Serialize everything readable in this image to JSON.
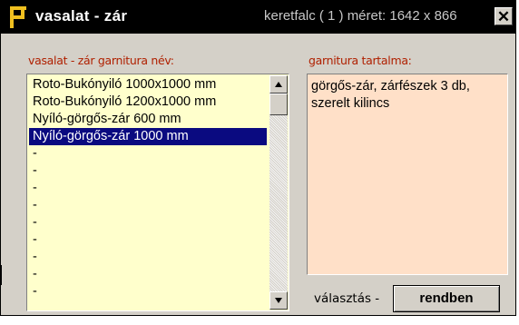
{
  "window": {
    "title": "vasalat - zár",
    "info": "keretfalc ( 1 ) méret: 1642 x 866",
    "close_glyph": "✕"
  },
  "list": {
    "label": "vasalat - zár garnitura név:",
    "items": [
      "Roto-Bukónyiló 1000x1000 mm",
      "Roto-Bukónyiló 1200x1000 mm",
      "Nyíló-görgős-zár 600 mm",
      "Nyíló-görgős-zár 1000 mm",
      "-",
      "-",
      "-",
      "-",
      "-",
      "-",
      "-",
      "-",
      "-"
    ],
    "selected_index": 3
  },
  "contents": {
    "label": "garnitura tartalma:",
    "lines": [
      "görgős-zár, zárfészek 3 db,",
      "szerelt kilincs"
    ]
  },
  "footer": {
    "choice_label": "választás -",
    "ok_label": "rendben"
  },
  "colors": {
    "titlebar": "#000000",
    "list_bg": "#ffffcc",
    "content_bg": "#ffe0c8",
    "label_red": "#b02000",
    "selection": "#0a0a80"
  },
  "icons": {
    "title": "key-icon",
    "scroll_up": "triangle-up-icon",
    "scroll_down": "triangle-down-icon"
  }
}
